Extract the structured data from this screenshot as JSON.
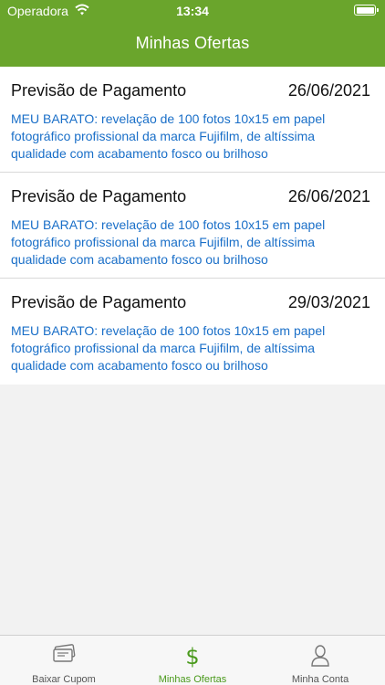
{
  "status_bar": {
    "carrier": "Operadora",
    "time": "13:34"
  },
  "header": {
    "title": "Minhas Ofertas"
  },
  "offers": [
    {
      "title": "Previsão de Pagamento",
      "date": "26/06/2021",
      "description": "MEU BARATO: revelação de 100 fotos 10x15 em papel fotográfico profissional da marca Fujifilm, de altíssima qualidade com acabamento fosco ou brilhoso"
    },
    {
      "title": "Previsão de Pagamento",
      "date": "26/06/2021",
      "description": "MEU BARATO: revelação de 100 fotos 10x15 em papel fotográfico profissional da marca Fujifilm, de altíssima qualidade com acabamento fosco ou brilhoso"
    },
    {
      "title": "Previsão de Pagamento",
      "date": "29/03/2021",
      "description": "MEU BARATO: revelação de 100 fotos 10x15 em papel fotográfico profissional da marca Fujifilm, de altíssima qualidade com acabamento fosco ou brilhoso"
    }
  ],
  "tabs": [
    {
      "label": "Baixar Cupom",
      "icon": "ticket-icon"
    },
    {
      "label": "Minhas Ofertas",
      "icon": "dollar-icon",
      "active": true
    },
    {
      "label": "Minha Conta",
      "icon": "person-icon"
    }
  ],
  "colors": {
    "header_bg": "#6aa52c",
    "link": "#1a6fc8",
    "active_tab": "#4a9a1c"
  }
}
